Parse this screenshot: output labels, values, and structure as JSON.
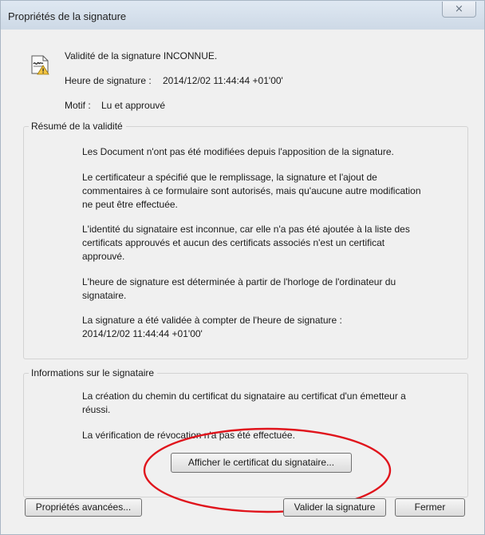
{
  "window": {
    "title": "Propriétés de la signature",
    "close_label": "⨯"
  },
  "summary": {
    "validity": "Validité de la signature INCONNUE.",
    "time_label": "Heure de signature :",
    "time_value": "2014/12/02 11:44:44 +01'00'",
    "reason_label": "Motif :",
    "reason_value": "Lu et approuvé"
  },
  "validity_section": {
    "legend": "Résumé de la validité",
    "lines": [
      [
        "Les Document n'ont pas été modifiées depuis l'apposition de la signature."
      ],
      [
        "Le certificateur a spécifié que le remplissage, la signature et l'ajout de",
        "commentaires à ce formulaire sont autorisés, mais qu'aucune autre modification",
        "ne peut être effectuée."
      ],
      [
        "L'identité du signataire est inconnue, car elle n'a pas été ajoutée à la liste des",
        "certificats approuvés et aucun des certificats associés n'est un certificat",
        "approuvé."
      ],
      [
        "L'heure de signature est déterminée à partir de l'horloge de l'ordinateur du",
        "signataire."
      ],
      [
        "La signature a été validée à compter de l'heure de signature :",
        "2014/12/02 11:44:44 +01'00'"
      ]
    ]
  },
  "signer_section": {
    "legend": "Informations sur le signataire",
    "lines": [
      [
        "La création du chemin du certificat du signataire au certificat d'un émetteur a",
        "réussi."
      ],
      [
        "La vérification de révocation n'a pas été effectuée."
      ]
    ],
    "show_cert_button": "Afficher le certificat du signataire..."
  },
  "footer": {
    "advanced_button": "Propriétés avancées...",
    "validate_button": "Valider la signature",
    "close_button": "Fermer"
  },
  "annotation": {
    "color": "#e0141c"
  }
}
